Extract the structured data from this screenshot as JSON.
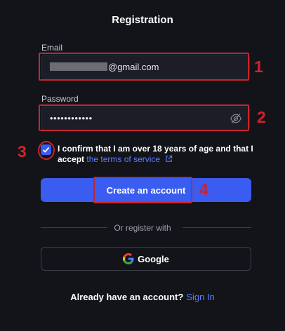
{
  "form": {
    "title": "Registration",
    "email_label": "Email",
    "email_value": "@gmail.com",
    "password_label": "Password",
    "password_value": "••••••••••••",
    "consent_text": "I confirm that I am over 18 years of age and that I accept",
    "consent_link": "the terms of service",
    "submit_label": "Create an account",
    "divider_text": "Or register with",
    "google_label": "Google",
    "footer_text": "Already have an account?",
    "footer_link": "Sign In"
  },
  "annotations": {
    "step1": "1",
    "step2": "2",
    "step3": "3",
    "step4": "4"
  },
  "icons": {
    "password_toggle": "eye-off-icon",
    "checkbox": "checkmark-icon",
    "terms_link": "external-link-icon",
    "google": "google-logo-icon"
  },
  "colors": {
    "background": "#13141a",
    "accent": "#3a5cf0",
    "link": "#5b7dff",
    "annotation_red": "#c6252f"
  }
}
